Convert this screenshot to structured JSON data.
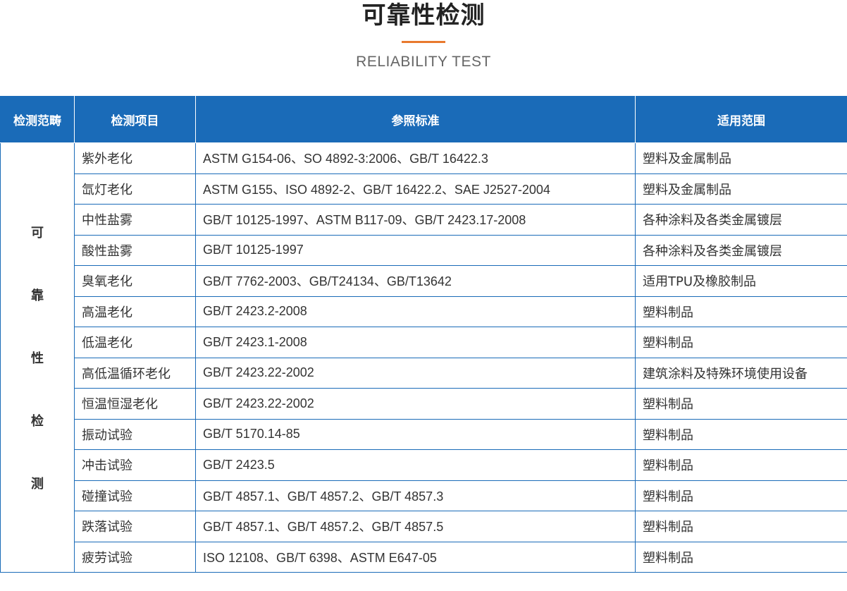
{
  "header": {
    "title": "可靠性检测",
    "subtitle": "RELIABILITY TEST",
    "accent_color": "#e8792e"
  },
  "table": {
    "header_color": "#1a6bb8",
    "columns": [
      "检测范畴",
      "检测项目",
      "参照标准",
      "适用范围"
    ],
    "category_chars": [
      "可",
      "靠",
      "性",
      "检",
      "测"
    ],
    "rows": [
      {
        "item": "紫外老化",
        "standard": "ASTM G154-06、SO 4892-3:2006、GB/T 16422.3",
        "scope": "塑料及金属制品"
      },
      {
        "item": "氙灯老化",
        "standard": "ASTM G155、ISO 4892-2、GB/T 16422.2、SAE J2527-2004",
        "scope": "塑料及金属制品"
      },
      {
        "item": "中性盐雾",
        "standard": "GB/T 10125-1997、ASTM B117-09、GB/T 2423.17-2008",
        "scope": "各种涂料及各类金属镀层"
      },
      {
        "item": "酸性盐雾",
        "standard": "GB/T 10125-1997",
        "scope": "各种涂料及各类金属镀层"
      },
      {
        "item": "臭氧老化",
        "standard": "GB/T 7762-2003、GB/T24134、GB/T13642",
        "scope": "适用TPU及橡胶制品"
      },
      {
        "item": "高温老化",
        "standard": "GB/T 2423.2-2008",
        "scope": "塑料制品"
      },
      {
        "item": "低温老化",
        "standard": "GB/T 2423.1-2008",
        "scope": "塑料制品"
      },
      {
        "item": "高低温循环老化",
        "standard": "GB/T 2423.22-2002",
        "scope": "建筑涂料及特殊环境使用设备"
      },
      {
        "item": "恒温恒湿老化",
        "standard": "GB/T 2423.22-2002",
        "scope": "塑料制品"
      },
      {
        "item": "振动试验",
        "standard": "GB/T 5170.14-85",
        "scope": "塑料制品"
      },
      {
        "item": "冲击试验",
        "standard": "GB/T 2423.5",
        "scope": "塑料制品"
      },
      {
        "item": "碰撞试验",
        "standard": "GB/T 4857.1、GB/T 4857.2、GB/T 4857.3",
        "scope": "塑料制品"
      },
      {
        "item": "跌落试验",
        "standard": "GB/T 4857.1、GB/T 4857.2、GB/T 4857.5",
        "scope": "塑料制品"
      },
      {
        "item": "疲劳试验",
        "standard": "ISO 12108、GB/T 6398、ASTM E647-05",
        "scope": "塑料制品"
      }
    ]
  }
}
